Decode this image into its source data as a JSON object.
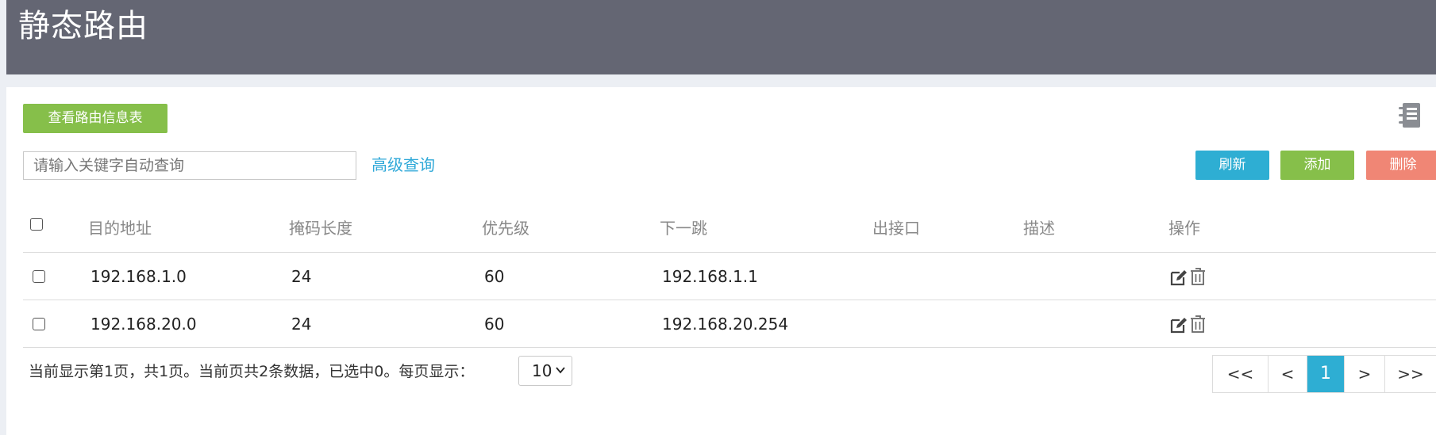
{
  "header": {
    "title": "静态路由"
  },
  "toolbar": {
    "view_table_label": "查看路由信息表",
    "refresh_label": "刷新",
    "add_label": "添加",
    "delete_label": "删除",
    "notebook_icon": "notebook-icon"
  },
  "search": {
    "placeholder": "请输入关键字自动查询",
    "value": "",
    "advanced_label": "高级查询"
  },
  "table": {
    "columns": [
      "目的地址",
      "掩码长度",
      "优先级",
      "下一跳",
      "出接口",
      "描述",
      "操作"
    ],
    "rows": [
      {
        "dest": "192.168.1.0",
        "mask": "24",
        "priority": "60",
        "next_hop": "192.168.1.1",
        "interface": "",
        "description": ""
      },
      {
        "dest": "192.168.20.0",
        "mask": "24",
        "priority": "60",
        "next_hop": "192.168.20.254",
        "interface": "",
        "description": ""
      }
    ],
    "row_actions": [
      "edit-icon",
      "trash-icon"
    ]
  },
  "footer": {
    "summary": "当前显示第1页，共1页。当前页共2条数据，已选中0。每页显示：",
    "page_size": "10"
  },
  "pagination": {
    "first": "<<",
    "prev": "<",
    "current": "1",
    "next": ">",
    "last": ">>"
  },
  "colors": {
    "header_bg": "#646673",
    "green": "#86bf4a",
    "blue": "#2eaed3",
    "red": "#f08675",
    "link": "#2ea8d8"
  }
}
